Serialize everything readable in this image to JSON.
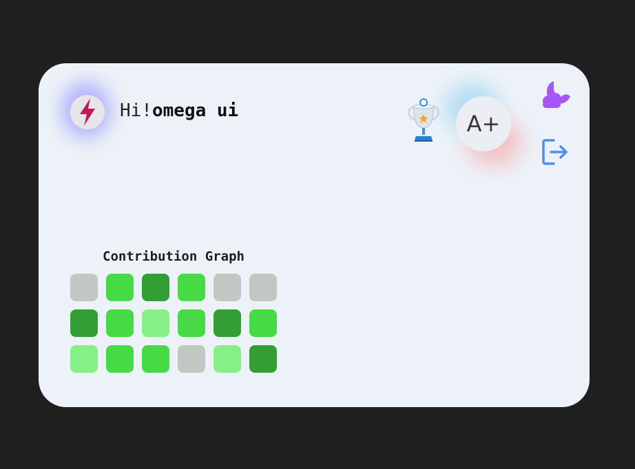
{
  "header": {
    "greeting": "Hi!",
    "user_name": "omega ui",
    "grade": "A+"
  },
  "icons": {
    "avatar": "lightning-bolt-icon",
    "trophy": "trophy-icon",
    "theme_toggle": "moon-cloud-icon",
    "logout": "logout-icon"
  },
  "colors": {
    "card_background": "#edf2f8",
    "page_background": "#1f1f1f",
    "bolt": "#c2185b",
    "moon": "#a855f7",
    "logout": "#4a8ff0"
  },
  "contribution_graph": {
    "title": "Contribution Graph",
    "levels": {
      "none": "#c1c7c1",
      "low": "#86ef86",
      "medium": "#46da46",
      "high": "#339e33"
    },
    "rows": [
      [
        "none",
        "medium",
        "high",
        "medium",
        "none",
        "none"
      ],
      [
        "high",
        "medium",
        "low",
        "medium",
        "high",
        "medium"
      ],
      [
        "low",
        "medium",
        "medium",
        "none",
        "low",
        "high"
      ]
    ]
  }
}
